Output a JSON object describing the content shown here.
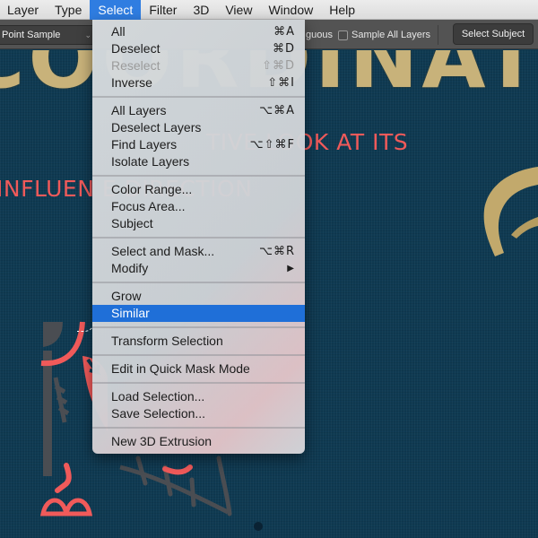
{
  "menubar": {
    "items": [
      {
        "label": "Layer"
      },
      {
        "label": "Type"
      },
      {
        "label": "Select",
        "active": true
      },
      {
        "label": "Filter"
      },
      {
        "label": "3D"
      },
      {
        "label": "View"
      },
      {
        "label": "Window"
      },
      {
        "label": "Help"
      }
    ]
  },
  "options_bar": {
    "sample_size_value": "Point Sample",
    "contiguous_label": "guous",
    "sample_all_layers_label": "Sample All Layers",
    "sample_all_layers_checked": false,
    "select_subject_label": "Select Subject"
  },
  "canvas": {
    "gold_title": "COORDINAT",
    "coral_line_1": "TIVE LOOK AT ITS",
    "coral_line_2": "INFLUEN                    E DIRECTION",
    "colors": {
      "background": "#0f3a52",
      "gold": "#c8b27a",
      "coral": "#f05a5a",
      "gray": "#4a4d52"
    }
  },
  "select_menu": {
    "groups": [
      [
        {
          "label": "All",
          "shortcut": "⌘A"
        },
        {
          "label": "Deselect",
          "shortcut": "⌘D"
        },
        {
          "label": "Reselect",
          "shortcut": "⇧⌘D",
          "disabled": true
        },
        {
          "label": "Inverse",
          "shortcut": "⇧⌘I"
        }
      ],
      [
        {
          "label": "All Layers",
          "shortcut": "⌥⌘A"
        },
        {
          "label": "Deselect Layers",
          "shortcut": ""
        },
        {
          "label": "Find Layers",
          "shortcut": "⌥⇧⌘F"
        },
        {
          "label": "Isolate Layers",
          "shortcut": ""
        }
      ],
      [
        {
          "label": "Color Range...",
          "shortcut": ""
        },
        {
          "label": "Focus Area...",
          "shortcut": ""
        },
        {
          "label": "Subject",
          "shortcut": ""
        }
      ],
      [
        {
          "label": "Select and Mask...",
          "shortcut": "⌥⌘R"
        },
        {
          "label": "Modify",
          "shortcut": "",
          "submenu": true
        }
      ],
      [
        {
          "label": "Grow",
          "shortcut": ""
        },
        {
          "label": "Similar",
          "shortcut": "",
          "highlighted": true
        }
      ],
      [
        {
          "label": "Transform Selection",
          "shortcut": ""
        }
      ],
      [
        {
          "label": "Edit in Quick Mask Mode",
          "shortcut": ""
        }
      ],
      [
        {
          "label": "Load Selection...",
          "shortcut": ""
        },
        {
          "label": "Save Selection...",
          "shortcut": ""
        }
      ],
      [
        {
          "label": "New 3D Extrusion",
          "shortcut": ""
        }
      ]
    ],
    "submenu_arrow_icon": "▶",
    "highlight_color": "#1f6fd8"
  }
}
